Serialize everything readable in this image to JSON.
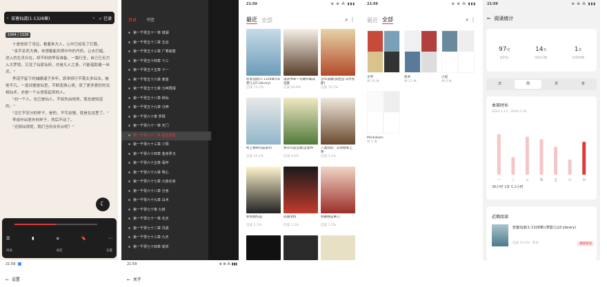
{
  "status": {
    "time": "21:59",
    "icons": "⊕ ⊗ ⁂ ▮▮▮"
  },
  "reader": {
    "title": "宏客仙道(1-1328章)",
    "done_label": "✓ 已读",
    "page_badge": "1064 / 1328",
    "paragraphs": [
      "十是他到了河边，看着朱大人，心中已经有了打算。",
      "\"亲手杀死大佛，本想着能到洞中作的丹药，让去打蜡，进入的生灵众在，却不料他早有准备，一路行至，自己已无力入大罗境，又没了仙家仙府，亦是凡人之身，只能借助着一丝灵。\"",
      "李道守留下的捕缴诸子多年，原来修行不需太多仙法，被他不凡，一息间便是仙官，不断变换心境，修了更多更好的法相仙术，亦是一个从修炼起来的人。",
      "\"刘一个人，也已是仙人，不如先由他来，我也是知道的。\"",
      "\"见它不安分的样子，是的，不可怠慢，就是在这里了。\"",
      "李成作出意外的样子，然后不动了。",
      "\"无相仙境呢，我们当何去何从呢？\""
    ],
    "controls": [
      "☰",
      "▮",
      "≡",
      "🔖",
      "⋯"
    ],
    "control_labels": [
      "目录",
      "",
      "进度",
      "",
      "设置"
    ]
  },
  "toc": {
    "tabs": [
      "目录",
      "书签"
    ],
    "chapters": [
      "第一千零五十一章 镜湖",
      "第一千零五十二章 五谷",
      "第一千零五十三章 广寒寂寞",
      "第一千零五十四章 十三",
      "第一千零五十五章 十一",
      "第一千零五十六章 麦苗",
      "第一千零五十七章 分神再相",
      "第一千零五十八章 醉仙",
      "第一千零五十九章 分神",
      "第一千零六十章 罗网",
      "第一千零六十一章 天门",
      "第一千零六十二章 晶莹剔透",
      "第一千零六十三章 少阳",
      "第一千零六十四章 金身罗汉",
      "第一千零六十五章 看杯",
      "第一千零六十六章 明心",
      "第一千零六十七章 九炼化身",
      "第一千零六十八章 分身",
      "第一千零六十九章 白术",
      "第一千零七十章 九转",
      "第一千零七十一章 先天",
      "第一千零七十二章 丹成",
      "第一千零七十三章 九天",
      "第一千零七十四章 斩妖"
    ],
    "highlight_index": 11
  },
  "shelf": {
    "tabs": [
      "最近",
      "全部"
    ],
    "books": [
      {
        "title": "宏客仙道(1-1328章)(李碧儿)(Z-Library)",
        "meta": "已读 73.1%"
      },
      {
        "title": "漫游书单一论著作集成选集",
        "meta": "已读 64.8%"
      },
      {
        "title": "百年孤独[加西亚·马尔克斯]",
        "meta": "已读 74.1%"
      },
      {
        "title": "村上春树作品系列",
        "meta": "已读 34.1%"
      },
      {
        "title": "余华作品全集(全套共",
        "meta": "已读 0.6%"
      },
      {
        "title": "人类简史：从动物到上帝",
        "meta": "已读 3.2%"
      },
      {
        "title": "新经典作品",
        "meta": "已读 2.1%"
      },
      {
        "title": "凤凰架构",
        "meta": "已读 1.2%"
      },
      {
        "title": "明朝那些事儿",
        "meta": "已读 1.5%"
      }
    ]
  },
  "groups": {
    "tabs": [
      "最近",
      "全部"
    ],
    "items": [
      {
        "name": "文学",
        "meta": "共 16 本"
      },
      {
        "name": "技术",
        "meta": "共 12 本"
      },
      {
        "name": "小说",
        "meta": "共 8 本"
      },
      {
        "name": "Markdown",
        "meta": "共 2 本"
      }
    ]
  },
  "stats": {
    "title": "阅读统计",
    "summary": [
      {
        "num": "97",
        "unit": "时",
        "label": "总时长"
      },
      {
        "num": "14",
        "unit": "天",
        "label": "阅读天数"
      },
      {
        "num": "1",
        "unit": "本",
        "label": "读完本数"
      }
    ],
    "periods": [
      "日",
      "周",
      "月",
      "年"
    ],
    "active_period": 1,
    "week_title": "本周时长",
    "week_range": "2024.5.13 - 2024.5.19",
    "week_legend": "36小时  1本  5.2小时",
    "recent_title": "近期阅读",
    "recent_book": "宏客仙道(1-1328章)(李碧儿)(Z-Library)",
    "recent_meta": "已读 73.1% · 昨天",
    "recent_button": "继续阅读"
  },
  "chart_data": {
    "type": "bar",
    "categories": [
      "一",
      "二",
      "三",
      "四",
      "五",
      "六",
      "日"
    ],
    "values": [
      1.6,
      0.7,
      1.5,
      1.4,
      1.1,
      0.6,
      1.3
    ],
    "title": "",
    "xlabel": "",
    "ylabel": "",
    "ylim": [
      0,
      2
    ]
  },
  "footer": {
    "left_time": "21:59",
    "left_title": "设置",
    "mid_time": "21:59",
    "mid_title": "关于"
  }
}
